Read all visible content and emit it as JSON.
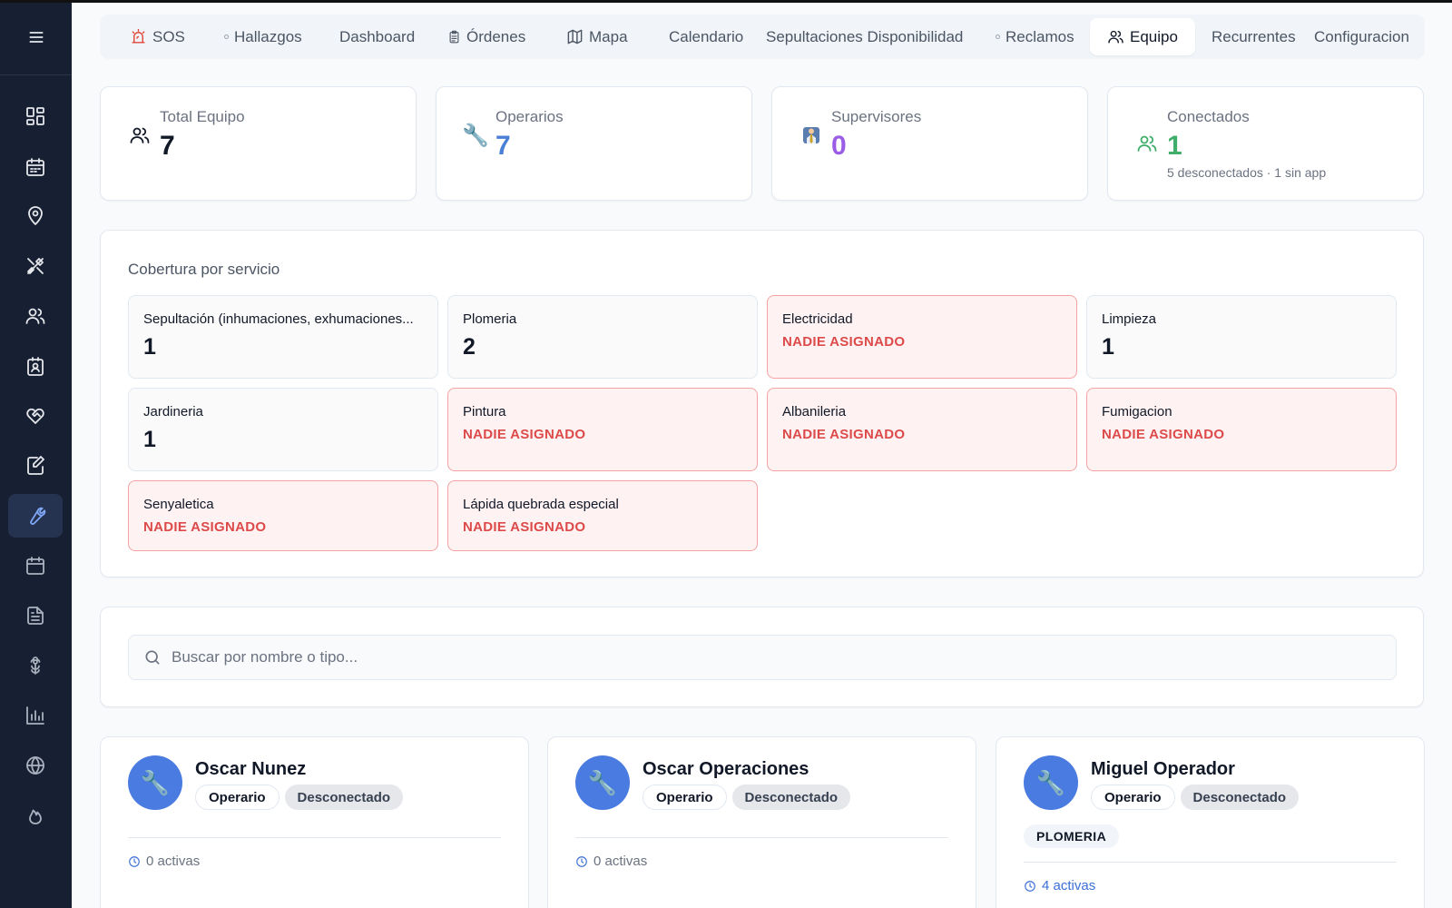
{
  "colors": {
    "sidebar_bg": "#172033",
    "accent_blue": "#4a7be0",
    "operarios_value": "#4a7fd6",
    "supervisores_value": "#9b5de5",
    "conectados_value": "#3fae6a",
    "warning_text": "#dc4a4a",
    "warning_bg": "#fef2f2"
  },
  "sidebar": {
    "menu_icon": "menu-icon",
    "items": [
      {
        "icon": "dashboard-grid-icon"
      },
      {
        "icon": "calendar-icon"
      },
      {
        "icon": "map-pin-icon"
      },
      {
        "icon": "tools-icon"
      },
      {
        "icon": "users-icon"
      },
      {
        "icon": "contact-badge-icon"
      },
      {
        "icon": "handshake-icon"
      },
      {
        "icon": "edit-document-icon"
      },
      {
        "icon": "wrench-icon",
        "active": true
      },
      {
        "icon": "calendar-icon"
      },
      {
        "icon": "document-icon"
      },
      {
        "icon": "flower-icon"
      },
      {
        "icon": "bar-chart-icon"
      },
      {
        "icon": "globe-icon"
      },
      {
        "icon": "flame-icon"
      }
    ]
  },
  "tabs": {
    "sos": "SOS",
    "hallazgos": "Hallazgos",
    "dashboard": "Dashboard",
    "ordenes": "Órdenes",
    "mapa": "Mapa",
    "calendario": "Calendario",
    "sepultaciones": "Sepultaciones Disponibilidad",
    "reclamos": "Reclamos",
    "equipo": "Equipo",
    "recurrentes": "Recurrentes",
    "configuracion": "Configuracion"
  },
  "stats": {
    "total": {
      "label": "Total Equipo",
      "value": "7",
      "icon": "users-icon"
    },
    "operarios": {
      "label": "Operarios",
      "value": "7",
      "icon": "wrench-icon"
    },
    "supervisores": {
      "label": "Supervisores",
      "value": "0",
      "icon": "supervisor-icon"
    },
    "conectados": {
      "label": "Conectados",
      "value": "1",
      "sub": "5 desconectados · 1 sin app",
      "icon": "users-icon"
    }
  },
  "coverage": {
    "title": "Cobertura por servicio",
    "unassigned_label": "NADIE ASIGNADO",
    "items": [
      {
        "name": "Sepultación (inhumaciones, exhumaciones...",
        "value": "1"
      },
      {
        "name": "Plomeria",
        "value": "2"
      },
      {
        "name": "Electricidad",
        "value": "NADIE ASIGNADO"
      },
      {
        "name": "Limpieza",
        "value": "1"
      },
      {
        "name": "Jardineria",
        "value": "1"
      },
      {
        "name": "Pintura",
        "value": "NADIE ASIGNADO"
      },
      {
        "name": "Albanileria",
        "value": "NADIE ASIGNADO"
      },
      {
        "name": "Fumigacion",
        "value": "NADIE ASIGNADO"
      },
      {
        "name": "Senyaletica",
        "value": "NADIE ASIGNADO"
      },
      {
        "name": "Lápida quebrada especial",
        "value": "NADIE ASIGNADO"
      }
    ]
  },
  "search": {
    "placeholder": "Buscar por nombre o tipo..."
  },
  "members": [
    {
      "name": "Oscar Nunez",
      "role": "Operario",
      "status": "Desconectado",
      "activas": "0 activas"
    },
    {
      "name": "Oscar Operaciones",
      "role": "Operario",
      "status": "Desconectado",
      "activas": "0 activas"
    },
    {
      "name": "Miguel Operador",
      "role": "Operario",
      "status": "Desconectado",
      "tag": "PLOMERIA",
      "activas": "4 activas"
    }
  ]
}
